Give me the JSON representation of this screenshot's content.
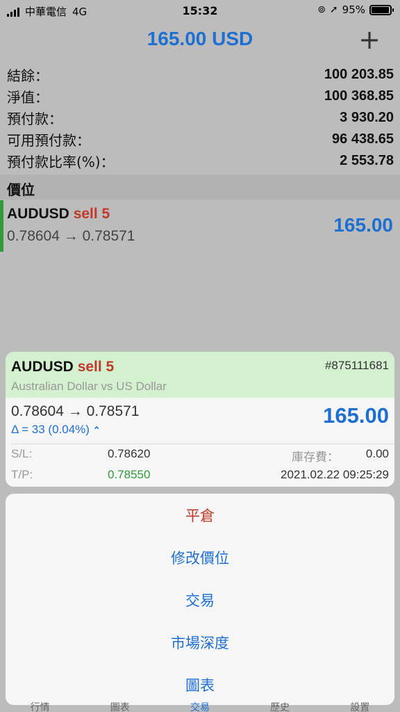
{
  "status_bar": {
    "carrier": "中華電信",
    "network": "4G",
    "time": "15:32",
    "battery": "95%",
    "battery_level": 0.95
  },
  "header": {
    "title": "165.00 USD",
    "add_icon": "plus-icon"
  },
  "summary": [
    {
      "label": "結餘：",
      "value": "100 203.85"
    },
    {
      "label": "淨值：",
      "value": "100 368.85"
    },
    {
      "label": "預付款：",
      "value": "3 930.20"
    },
    {
      "label": "可用預付款：",
      "value": "96 438.65"
    },
    {
      "label": "預付款比率(%)：",
      "value": "2 553.78"
    }
  ],
  "section": {
    "title": "價位"
  },
  "position": {
    "symbol": "AUDUSD",
    "type": "sell 5",
    "prices": "0.78604 → 0.78571",
    "profit": "165.00"
  },
  "detail": {
    "symbol": "AUDUSD",
    "type": "sell 5",
    "ticket": "#875111681",
    "description": "Australian Dollar vs US Dollar",
    "prices": "0.78604 → 0.78571",
    "delta": "Δ = 33 (0.04%)",
    "profit": "165.00",
    "sl_label": "S/L:",
    "sl_value": "0.78620",
    "tp_label": "T/P:",
    "tp_value": "0.78550",
    "swap_label": "庫存費：",
    "swap_value": "0.00",
    "datetime": "2021.02.22 09:25:29"
  },
  "actions": [
    {
      "label": "平倉",
      "color": "#c0392b"
    },
    {
      "label": "修改價位",
      "color": "#1d6fd1"
    },
    {
      "label": "交易",
      "color": "#1d6fd1"
    },
    {
      "label": "市場深度",
      "color": "#1d6fd1"
    },
    {
      "label": "圖表",
      "color": "#1d6fd1"
    }
  ],
  "tabs": [
    "行情",
    "圖表",
    "交易",
    "歷史",
    "設置"
  ],
  "colors": {
    "accent": "#1d6fd1",
    "sell": "#c0392b",
    "profit_bar": "#2e9a3a",
    "card_header": "#d3f0cf"
  }
}
